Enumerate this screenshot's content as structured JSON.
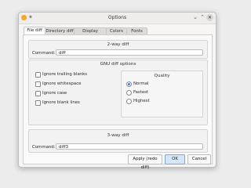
{
  "window": {
    "title": "Options"
  },
  "titlebar": {
    "pin_glyph": "✶",
    "minimize_glyph": "⌄",
    "maximize_glyph": "⌃",
    "close_glyph": "✕"
  },
  "tabs": [
    {
      "label": "File diff",
      "active": true
    },
    {
      "label": "Directory diff",
      "active": false
    },
    {
      "label": "Display options",
      "active": false
    },
    {
      "label": "Colors",
      "active": false
    },
    {
      "label": "Fonts",
      "active": false
    }
  ],
  "two_way": {
    "title": "2-way diff",
    "command_label": "Command:",
    "command_value": "diff"
  },
  "gnu": {
    "title": "GNU diff options",
    "checkboxes": [
      {
        "label": "Ignore trailing blanks",
        "checked": false
      },
      {
        "label": "Ignore whitespace",
        "checked": false
      },
      {
        "label": "Ignore case",
        "checked": false
      },
      {
        "label": "Ignore blank lines",
        "checked": false
      }
    ],
    "quality": {
      "title": "Quality",
      "options": [
        {
          "label": "Normal",
          "selected": true
        },
        {
          "label": "Fastest",
          "selected": false
        },
        {
          "label": "Highest",
          "selected": false
        }
      ]
    }
  },
  "three_way": {
    "title": "3-way diff",
    "command_label": "Command:",
    "command_value": "diff3"
  },
  "buttons": {
    "apply": "Apply (redo diff)",
    "ok": "OK",
    "cancel": "Cancel"
  },
  "colors": {
    "accent": "#3584e4",
    "app_icon": "#f5a623"
  }
}
